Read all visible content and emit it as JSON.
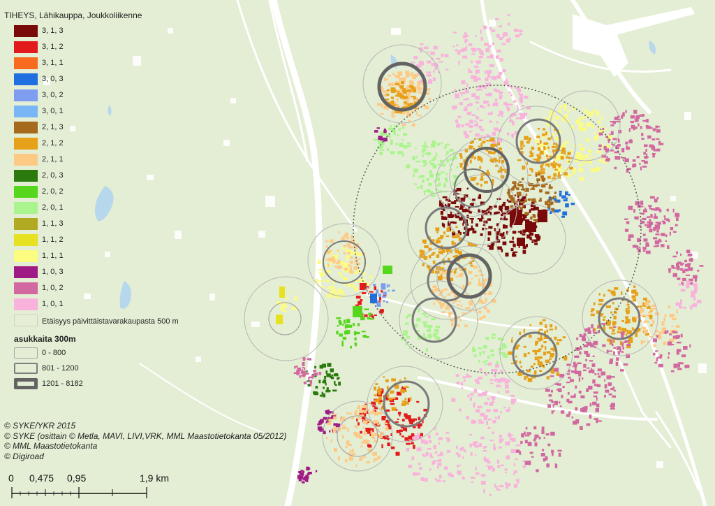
{
  "legend": {
    "title": "TIHEYS, Lähikauppa, Joukkoliikenne",
    "classes": [
      {
        "label": "3, 1, 3",
        "color": "#7a0a0a"
      },
      {
        "label": "3, 1, 2",
        "color": "#e31a1c"
      },
      {
        "label": "3, 1, 1",
        "color": "#f86a1e"
      },
      {
        "label": "3, 0, 3",
        "color": "#1f6fe0"
      },
      {
        "label": "3, 0, 2",
        "color": "#7f9df0"
      },
      {
        "label": "3, 0, 1",
        "color": "#7ab6f5"
      },
      {
        "label": "2, 1, 3",
        "color": "#a66a1c"
      },
      {
        "label": "2, 1, 2",
        "color": "#e6a01a"
      },
      {
        "label": "2, 1, 1",
        "color": "#fdca86"
      },
      {
        "label": "2, 0, 3",
        "color": "#2a7a0e"
      },
      {
        "label": "2, 0, 2",
        "color": "#56d61c"
      },
      {
        "label": "2, 0, 1",
        "color": "#aaf48e"
      },
      {
        "label": "1, 1, 3",
        "color": "#b0aa22"
      },
      {
        "label": "1, 1, 2",
        "color": "#e6e222"
      },
      {
        "label": "1, 1, 1",
        "color": "#fcfc80"
      },
      {
        "label": "1, 0, 3",
        "color": "#a01a86"
      },
      {
        "label": "1, 0, 2",
        "color": "#d268a0"
      },
      {
        "label": "1, 0, 1",
        "color": "#f8b2dc"
      }
    ],
    "distance_label": "Etäisyys päivittäistavarakaupasta 500 m",
    "size_title": "asukkaita 300m",
    "size_classes": [
      {
        "label": "0 - 800",
        "stroke": "#a8a8a8"
      },
      {
        "label": "801 - 1200",
        "stroke": "#7e7e7e"
      },
      {
        "label": "1201 - 8182",
        "stroke": "#636363"
      }
    ]
  },
  "credits": [
    "© SYKE/YKR 2015",
    "© SYKE (osittain © Metla, MAVI, LIVI,VRK, MML Maastotietokanta 05/2012)",
    "© MML Maastotietokanta",
    "© Digiroad"
  ],
  "scalebar": {
    "labels": [
      "0",
      "0,475",
      "0,95",
      "1,9 km"
    ]
  },
  "colors": {
    "background": "#e4eed4",
    "water": "#b6d7ec",
    "road": "#ffffff",
    "service_area": "#e6efd6"
  }
}
